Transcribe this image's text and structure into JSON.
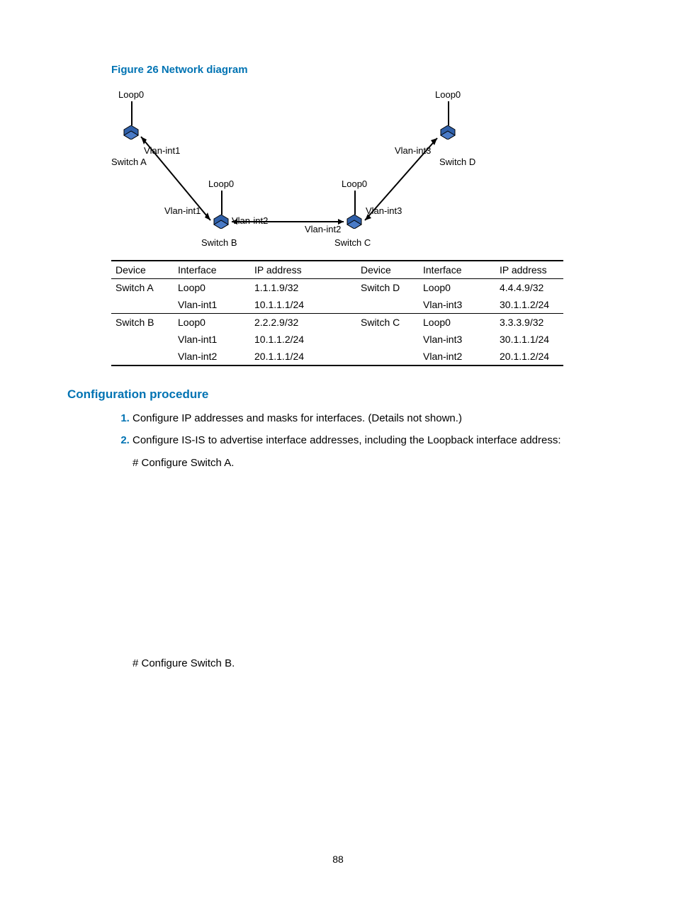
{
  "figure_title": "Figure 26 Network diagram",
  "diagram": {
    "switch_a": {
      "name": "Switch A",
      "loop": "Loop0",
      "port": "Vlan-int1"
    },
    "switch_b": {
      "name": "Switch B",
      "loop": "Loop0",
      "port_l": "Vlan-int1",
      "port_r": "Vlan-int2"
    },
    "switch_c": {
      "name": "Switch C",
      "loop": "Loop0",
      "port_l": "Vlan-int2",
      "port_r": "Vlan-int3"
    },
    "switch_d": {
      "name": "Switch D",
      "loop": "Loop0",
      "port": "Vlan-int3"
    }
  },
  "table": {
    "headers": [
      "Device",
      "Interface",
      "IP address",
      "Device",
      "Interface",
      "IP address"
    ],
    "rows": [
      {
        "d1": "Switch A",
        "i1": "Loop0",
        "a1": "1.1.1.9/32",
        "d2": "Switch D",
        "i2": "Loop0",
        "a2": "4.4.4.9/32",
        "sep": false
      },
      {
        "d1": "",
        "i1": "Vlan-int1",
        "a1": "10.1.1.1/24",
        "d2": "",
        "i2": "Vlan-int3",
        "a2": "30.1.1.2/24",
        "sep": false
      },
      {
        "d1": "Switch B",
        "i1": "Loop0",
        "a1": "2.2.2.9/32",
        "d2": "Switch C",
        "i2": "Loop0",
        "a2": "3.3.3.9/32",
        "sep": true
      },
      {
        "d1": "",
        "i1": "Vlan-int1",
        "a1": "10.1.1.2/24",
        "d2": "",
        "i2": "Vlan-int3",
        "a2": "30.1.1.1/24",
        "sep": false
      },
      {
        "d1": "",
        "i1": "Vlan-int2",
        "a1": "20.1.1.1/24",
        "d2": "",
        "i2": "Vlan-int2",
        "a2": "20.1.1.2/24",
        "sep": false
      }
    ]
  },
  "section_title": "Configuration procedure",
  "steps": {
    "s1": "Configure IP addresses and masks for interfaces. (Details not shown.)",
    "s2": "Configure IS-IS to advertise interface addresses, including the Loopback interface address:",
    "s2a": "# Configure Switch A.",
    "s2b": "# Configure Switch B."
  },
  "page_number": "88"
}
